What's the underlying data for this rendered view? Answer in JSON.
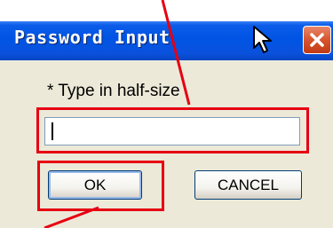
{
  "dialog": {
    "title": "Password Input",
    "prompt": "* Type in half-size",
    "input_value": "",
    "ok_label": "OK",
    "cancel_label": "CANCEL"
  },
  "icons": {
    "close": "close-icon",
    "cursor": "mouse-pointer-icon"
  },
  "colors": {
    "titlebar": "#0054e3",
    "dialog_background": "#ece9d8",
    "close_button": "#d7542e",
    "highlight": "#e60012"
  }
}
